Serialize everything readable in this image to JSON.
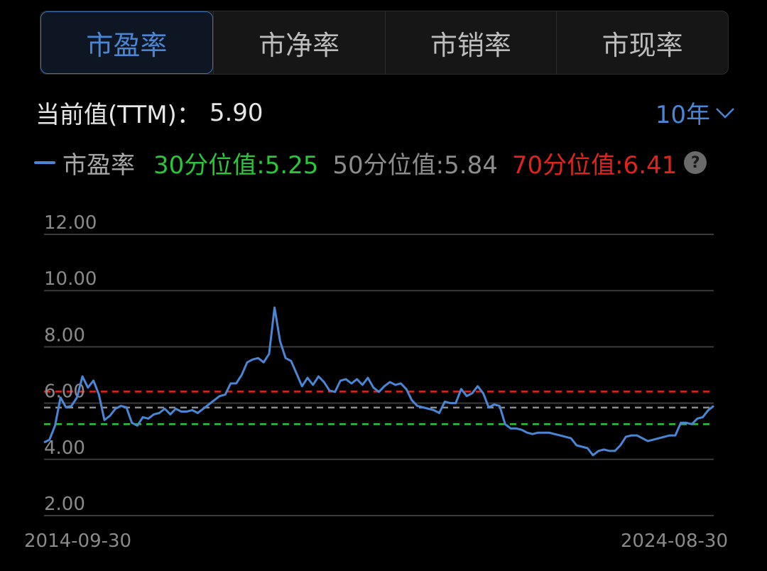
{
  "tabs": [
    {
      "label": "市盈率",
      "active": true
    },
    {
      "label": "市净率",
      "active": false
    },
    {
      "label": "市销率",
      "active": false
    },
    {
      "label": "市现率",
      "active": false
    }
  ],
  "current": {
    "label": "当前值(TTM)：",
    "value": "5.90"
  },
  "range": {
    "label": "10年"
  },
  "legend": {
    "series_name": "市盈率",
    "p30": "30分位值:5.25",
    "p50": "50分位值:5.84",
    "p70": "70分位值:6.41",
    "help": "?"
  },
  "colors": {
    "line": "#4a86d4",
    "p30": "#2bc43a",
    "p50": "#8c8c8c",
    "p70": "#e0241c",
    "grid": "#3a3a3a"
  },
  "chart_data": {
    "type": "line",
    "ylim": [
      2,
      12
    ],
    "yticks": [
      "12.00",
      "10.00",
      "8.00",
      "6.00",
      "4.00",
      "2.00"
    ],
    "x_start_label": "2014-09-30",
    "x_end_label": "2024-08-30",
    "reference_lines": [
      {
        "value": 6.41,
        "color": "#e0241c"
      },
      {
        "value": 5.84,
        "color": "#8c8c8c"
      },
      {
        "value": 5.25,
        "color": "#2bc43a"
      }
    ],
    "series": [
      {
        "values": [
          4.6,
          4.7,
          5.2,
          6.2,
          5.85,
          5.9,
          6.2,
          6.95,
          6.55,
          6.8,
          6.3,
          5.4,
          5.55,
          5.8,
          5.9,
          5.85,
          5.3,
          5.2,
          5.5,
          5.45,
          5.6,
          5.65,
          5.8,
          5.6,
          5.8,
          5.7,
          5.7,
          5.75,
          5.65,
          5.8,
          5.95,
          6.1,
          6.25,
          6.3,
          6.7,
          6.7,
          7.0,
          7.45,
          7.55,
          7.6,
          7.45,
          7.75,
          9.4,
          8.2,
          7.6,
          7.5,
          7.05,
          6.6,
          6.9,
          6.65,
          6.95,
          6.75,
          6.45,
          6.4,
          6.8,
          6.85,
          6.7,
          6.85,
          6.65,
          6.9,
          6.55,
          6.4,
          6.6,
          6.75,
          6.65,
          6.7,
          6.5,
          6.1,
          5.9,
          5.85,
          5.8,
          5.75,
          5.65,
          6.05,
          6.0,
          6.0,
          6.5,
          6.25,
          6.35,
          6.6,
          6.35,
          5.85,
          5.95,
          5.9,
          5.25,
          5.1,
          5.1,
          5.05,
          4.95,
          4.9,
          4.95,
          4.95,
          4.95,
          4.9,
          4.85,
          4.8,
          4.75,
          4.5,
          4.45,
          4.4,
          4.15,
          4.3,
          4.35,
          4.3,
          4.3,
          4.5,
          4.8,
          4.85,
          4.85,
          4.75,
          4.65,
          4.7,
          4.75,
          4.8,
          4.85,
          4.85,
          5.3,
          5.3,
          5.25,
          5.45,
          5.5,
          5.75,
          5.9
        ]
      }
    ]
  }
}
